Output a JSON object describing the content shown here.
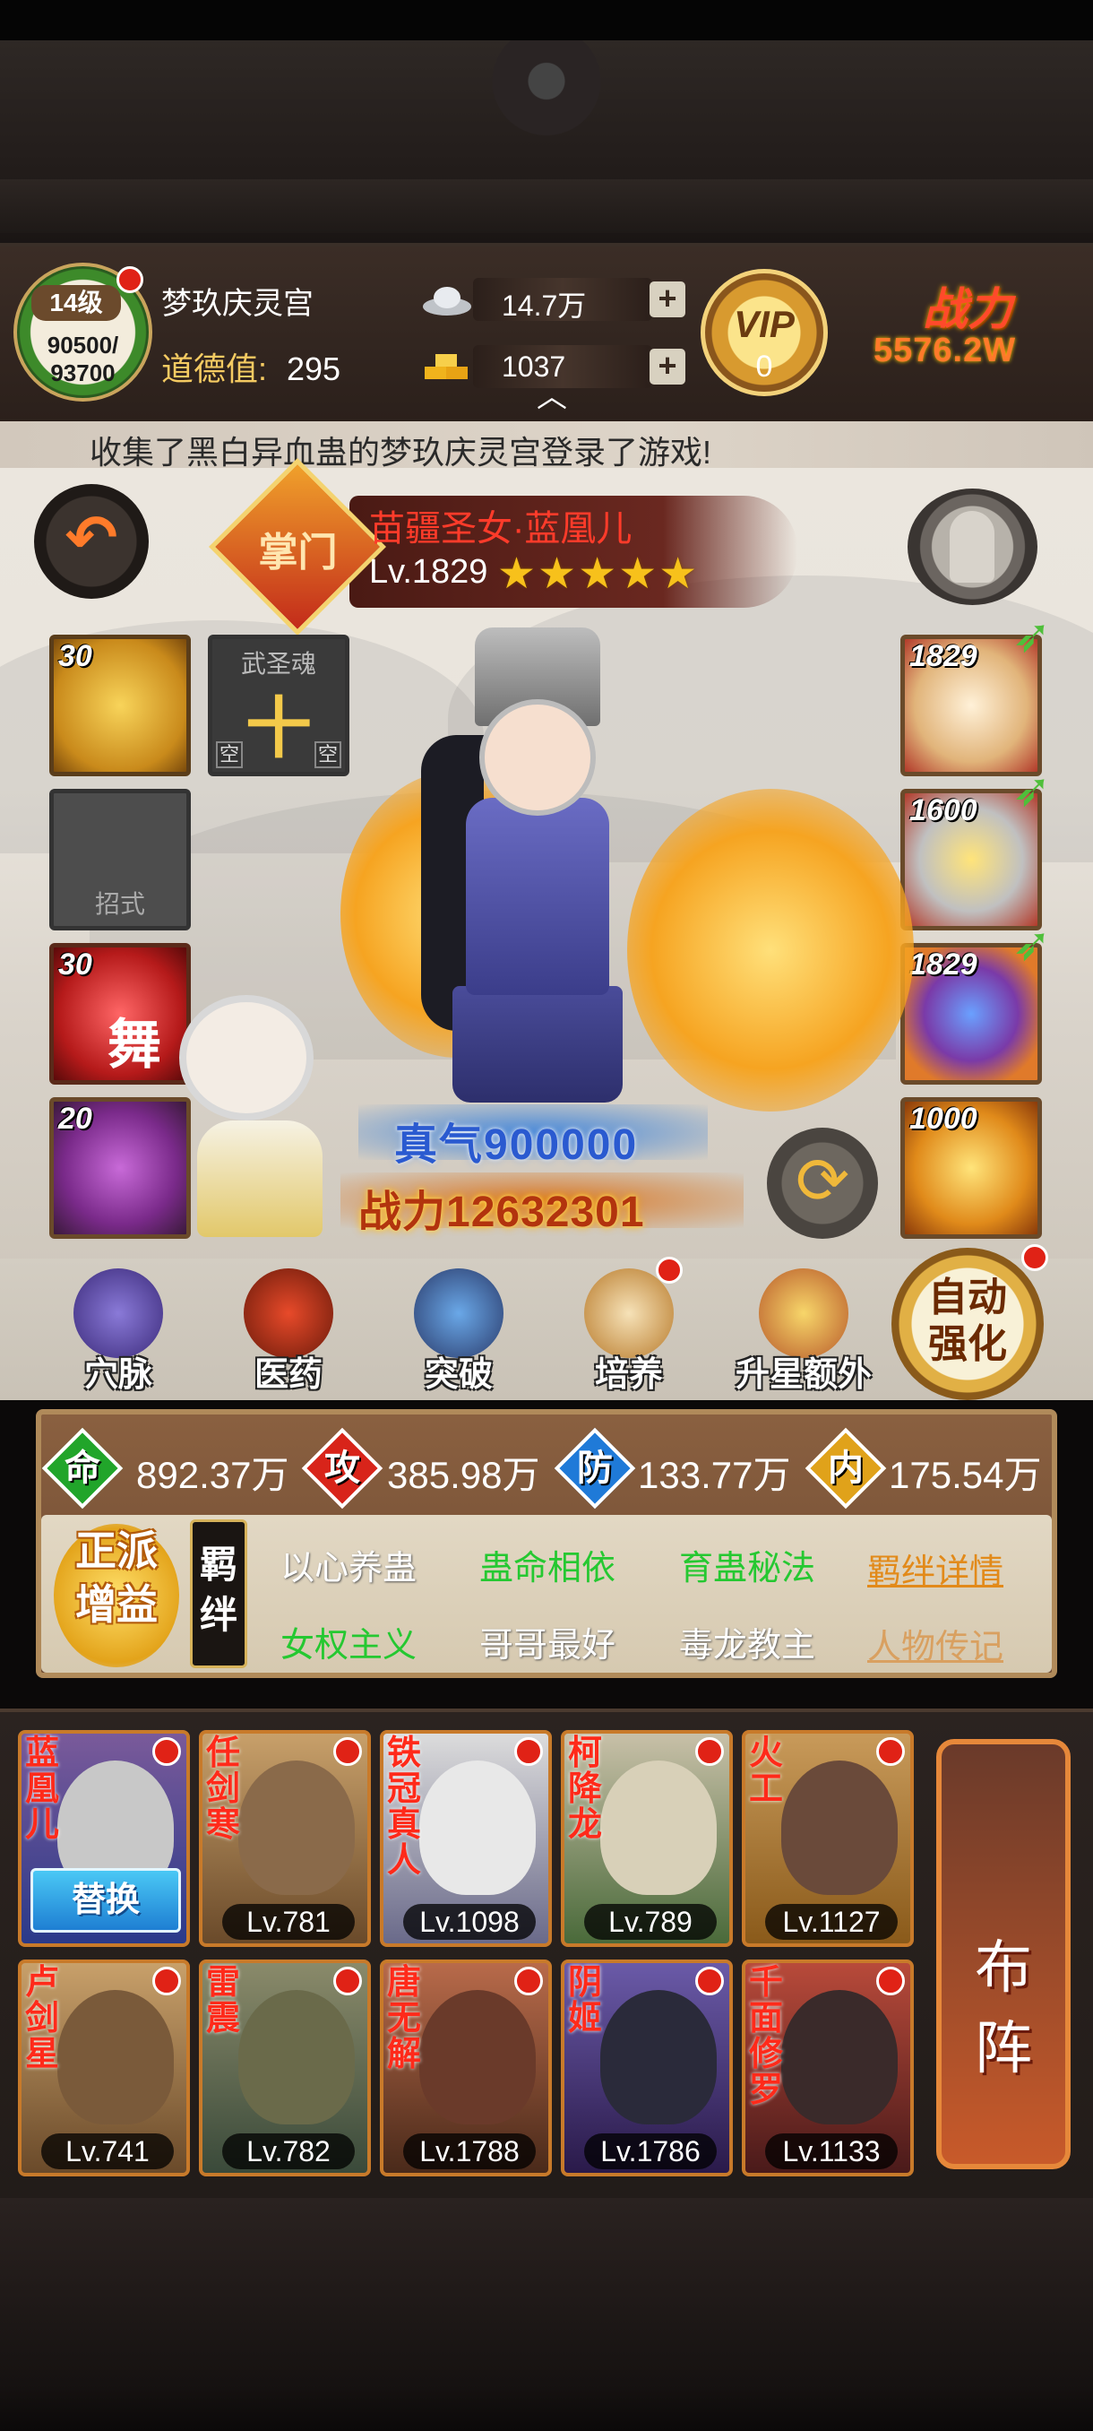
{
  "player": {
    "level_label": "14级",
    "exp": "90500/",
    "exp_max": "93700",
    "name": "梦玖庆灵宫",
    "morality_label": "道德值:",
    "morality_value": "295"
  },
  "currency": {
    "silver": "14.7万",
    "gold": "1037"
  },
  "vip": {
    "label": "VIP",
    "level": "0"
  },
  "power": {
    "label": "战力",
    "value": "5576.2W"
  },
  "notice": "收集了黑白异血蛊的梦玖庆灵宫登录了游戏!",
  "hero": {
    "badge": "掌门",
    "title": "苗疆圣女·蓝凰儿",
    "level": "Lv.1829",
    "stars": "★★★★★",
    "qi": "真气900000",
    "combat_power": "战力12632301"
  },
  "left_slots": [
    {
      "num": "30"
    },
    {
      "soul_title": "武圣魂",
      "soul_char": "十",
      "empty_left": "空",
      "empty_right": "空"
    },
    {
      "label": "招式"
    },
    {
      "num": "30",
      "glyph": "舞"
    },
    {
      "num": "20"
    }
  ],
  "right_slots": [
    {
      "num": "1829"
    },
    {
      "num": "1600"
    },
    {
      "num": "1829"
    },
    {
      "num": "1000"
    }
  ],
  "functions": [
    {
      "label": "穴脉"
    },
    {
      "label": "医药"
    },
    {
      "label": "突破"
    },
    {
      "label": "培养"
    },
    {
      "label": "升星额外"
    }
  ],
  "auto_enhance": {
    "line1": "自动",
    "line2": "强化"
  },
  "attributes": [
    {
      "char": "命",
      "value": "892.37万",
      "color": "#21a52a"
    },
    {
      "char": "攻",
      "value": "385.98万",
      "color": "#d8241a"
    },
    {
      "char": "防",
      "value": "133.77万",
      "color": "#1f7ad8"
    },
    {
      "char": "内",
      "value": "175.54万",
      "color": "#e0a21a"
    }
  ],
  "faction": {
    "line1": "正派",
    "line2": "增益"
  },
  "bond_tag": {
    "line1": "羁",
    "line2": "绊"
  },
  "bonds": {
    "row1": [
      "以心养蛊",
      "蛊命相依",
      "育蛊秘法"
    ],
    "row2": [
      "女权主义",
      "哥哥最好",
      "毒龙教主"
    ],
    "link_details": "羁绊详情",
    "link_bio": "人物传记"
  },
  "roster": {
    "row1": [
      {
        "name": "蓝凰儿",
        "swap": "替换"
      },
      {
        "name": "任剑寒",
        "level": "Lv.781"
      },
      {
        "name": "铁冠真人",
        "level": "Lv.1098"
      },
      {
        "name": "柯降龙",
        "level": "Lv.789"
      },
      {
        "name": "火工",
        "level": "Lv.1127"
      }
    ],
    "row2": [
      {
        "name": "卢剑星",
        "level": "Lv.741"
      },
      {
        "name": "雷震",
        "level": "Lv.782"
      },
      {
        "name": "唐无解",
        "level": "Lv.1788"
      },
      {
        "name": "阴姬",
        "level": "Lv.1786"
      },
      {
        "name": "千面修罗",
        "level": "Lv.1133"
      }
    ]
  },
  "formation": {
    "line1": "布",
    "line2": "阵"
  }
}
